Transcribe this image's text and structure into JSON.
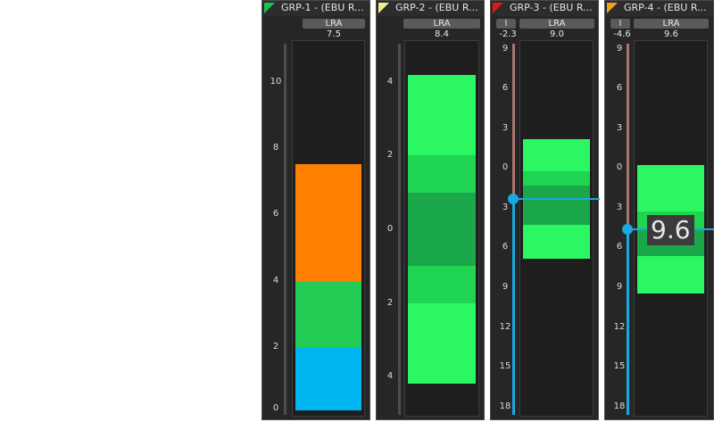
{
  "colors": {
    "orange": "#ff7f00",
    "green": "#22cc55",
    "blue": "#00b6f0",
    "brightGreen": "#2bf763",
    "midGreen": "#1fd451",
    "darkGreen": "#1aa84b"
  },
  "groups": [
    {
      "name": "GRP-1 - (EBU R...",
      "flag_color": "#1ac34a",
      "label": "LRA",
      "value": "7.5",
      "scale": [
        "10",
        "8",
        "6",
        "4",
        "2",
        "0"
      ]
    },
    {
      "name": "GRP-2 - (EBU R...",
      "flag_color": "#f2ec8a",
      "label": "LRA",
      "value": "8.4",
      "scale": [
        "4",
        "2",
        "0",
        "2",
        "4"
      ]
    },
    {
      "name": "GRP-3 - (EBU R...",
      "flag_color": "#e01818",
      "label": "LRA",
      "small_label": "I",
      "small_value": "-2.3",
      "value": "9.0",
      "scale": [
        "9",
        "6",
        "3",
        "0",
        "3",
        "6",
        "9",
        "12",
        "15",
        "18"
      ]
    },
    {
      "name": "GRP-4 - (EBU R...",
      "flag_color": "#f0a020",
      "label": "LRA",
      "small_label": "I",
      "small_value": "-4.6",
      "value": "9.6",
      "scale": [
        "9",
        "6",
        "3",
        "0",
        "3",
        "6",
        "9",
        "12",
        "15",
        "18"
      ],
      "tooltip": "9.6"
    }
  ]
}
